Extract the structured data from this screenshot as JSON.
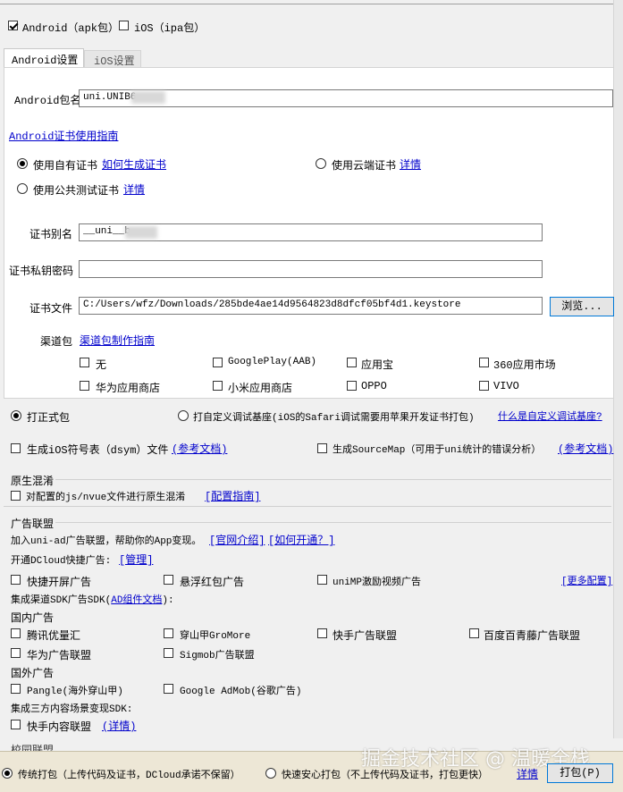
{
  "platform": {
    "android_label": "Android（apk包）",
    "ios_label": "iOS（ipa包）"
  },
  "tabs": [
    {
      "label": "Android设置"
    },
    {
      "label": "iOS设置"
    }
  ],
  "android": {
    "package_label": "Android包名",
    "package_value": "uni.UNIB6",
    "cert_guide_link": "Android证书使用指南",
    "use_own_cert": "使用自有证书",
    "how_to_generate": "如何生成证书",
    "use_cloud_cert": "使用云端证书",
    "cloud_detail": "详情",
    "use_public_cert": "使用公共测试证书",
    "public_detail": "详情",
    "alias_label": "证书别名",
    "alias_value": "__uni__b",
    "password_label": "证书私钥密码",
    "password_value": "",
    "file_label": "证书文件",
    "file_value": "C:/Users/wfz/Downloads/285bde4ae14d9564823d8dfcf05bf4d1.keystore",
    "browse_button": "浏览...",
    "channel_label": "渠道包",
    "channel_guide": "渠道包制作指南",
    "channels": [
      "无",
      "GooglePlay(AAB)",
      "应用宝",
      "360应用市场",
      "华为应用商店",
      "小米应用商店",
      "OPPO",
      "VIVO"
    ]
  },
  "build": {
    "release_label": "打正式包",
    "custom_debug_label": "打自定义调试基座(iOS的Safari调试需要用苹果开发证书打包)",
    "what_is_custom": "什么是自定义调试基座?",
    "dsym_label": "生成iOS符号表（dsym）文件",
    "dsym_ref": "(参考文档)",
    "sourcemap_label": "生成SourceMap（可用于uni统计的错误分析）",
    "sourcemap_ref": "(参考文档)"
  },
  "obfuscation": {
    "title": "原生混淆",
    "option": "对配置的js/nvue文件进行原生混淆",
    "guide": "[配置指南]"
  },
  "ads": {
    "title": "广告联盟",
    "intro": "加入uni-ad广告联盟，帮助你的App变现。",
    "official_link": "[官网介绍]",
    "how_to_open": "[如何开通？]",
    "quick_label": "开通DCloud快捷广告:",
    "manage_link": "[管理]",
    "quick_items": [
      "快捷开屏广告",
      "悬浮红包广告",
      "uniMP激励视频广告"
    ],
    "more_config": "[更多配置]",
    "sdk_label": "集成渠道SDK广告SDK(",
    "sdk_link": "AD组件文档",
    "sdk_tail": "):",
    "domestic_label": "国内广告",
    "domestic_items": [
      "腾讯优量汇",
      "穿山甲GroMore",
      "快手广告联盟",
      "百度百青藤广告联盟",
      "华为广告联盟",
      "Sigmob广告联盟"
    ],
    "foreign_label": "国外广告",
    "foreign_items": [
      "Pangle(海外穿山甲)",
      "Google AdMob(谷歌广告)"
    ],
    "third_label": "集成三方内容场景变现SDK:",
    "third_items": [
      "快手内容联盟"
    ],
    "third_detail": "(详情)",
    "cut_text": "校园联盟"
  },
  "footer": {
    "traditional_label": "传统打包（上传代码及证书，DCloud承诺不保留）",
    "fast_label": "快速安心打包（不上传代码及证书，打包更快）",
    "detail_link": "详情",
    "pack_button": "打包(P)"
  },
  "watermark": "掘金技术社区 @ 温暖全栈"
}
